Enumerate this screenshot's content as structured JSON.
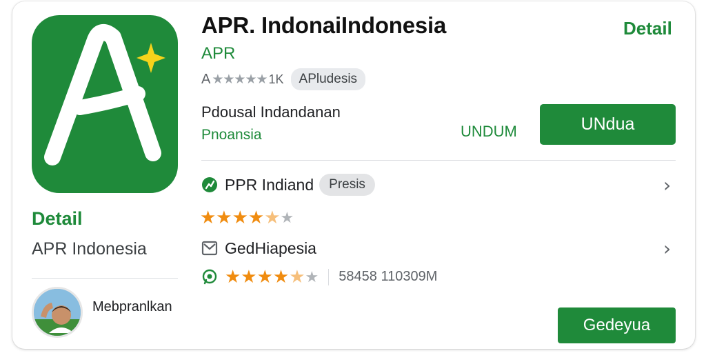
{
  "app": {
    "title": "APR. IndonaiIndonesia",
    "publisher": "APR",
    "detail_link": "Detail",
    "rating_prefix": "A",
    "rating_stars": "★★★★★",
    "rating_suffix": "1K",
    "category_chip": "APludesis",
    "description": "Pdousal Indandanan",
    "region": "Pnoansia",
    "undum_label": "UNDUM",
    "install_button": "UNdua"
  },
  "left": {
    "detail": "Detail",
    "name": "APR Indonesia",
    "avatar_caption": "Mebpranlkan"
  },
  "list": [
    {
      "label": "PPR Indiand",
      "chip": "Presis",
      "icon": "play-store-icon",
      "rating_full": "★★★★",
      "rating_half": "★",
      "rating_off": "★"
    },
    {
      "label": "GedHiapesia",
      "icon": "mail-icon",
      "meta_icon": "whatsapp-icon",
      "rating_full": "★★★★",
      "rating_half": "★",
      "rating_off": "★",
      "meta": "58458 110309M"
    }
  ],
  "chevron": "›",
  "secondary_button": "Gedeyua",
  "colors": {
    "brand_green": "#1f8a3a",
    "star_orange": "#f08c10",
    "star_yellow": "#f6d31b"
  }
}
